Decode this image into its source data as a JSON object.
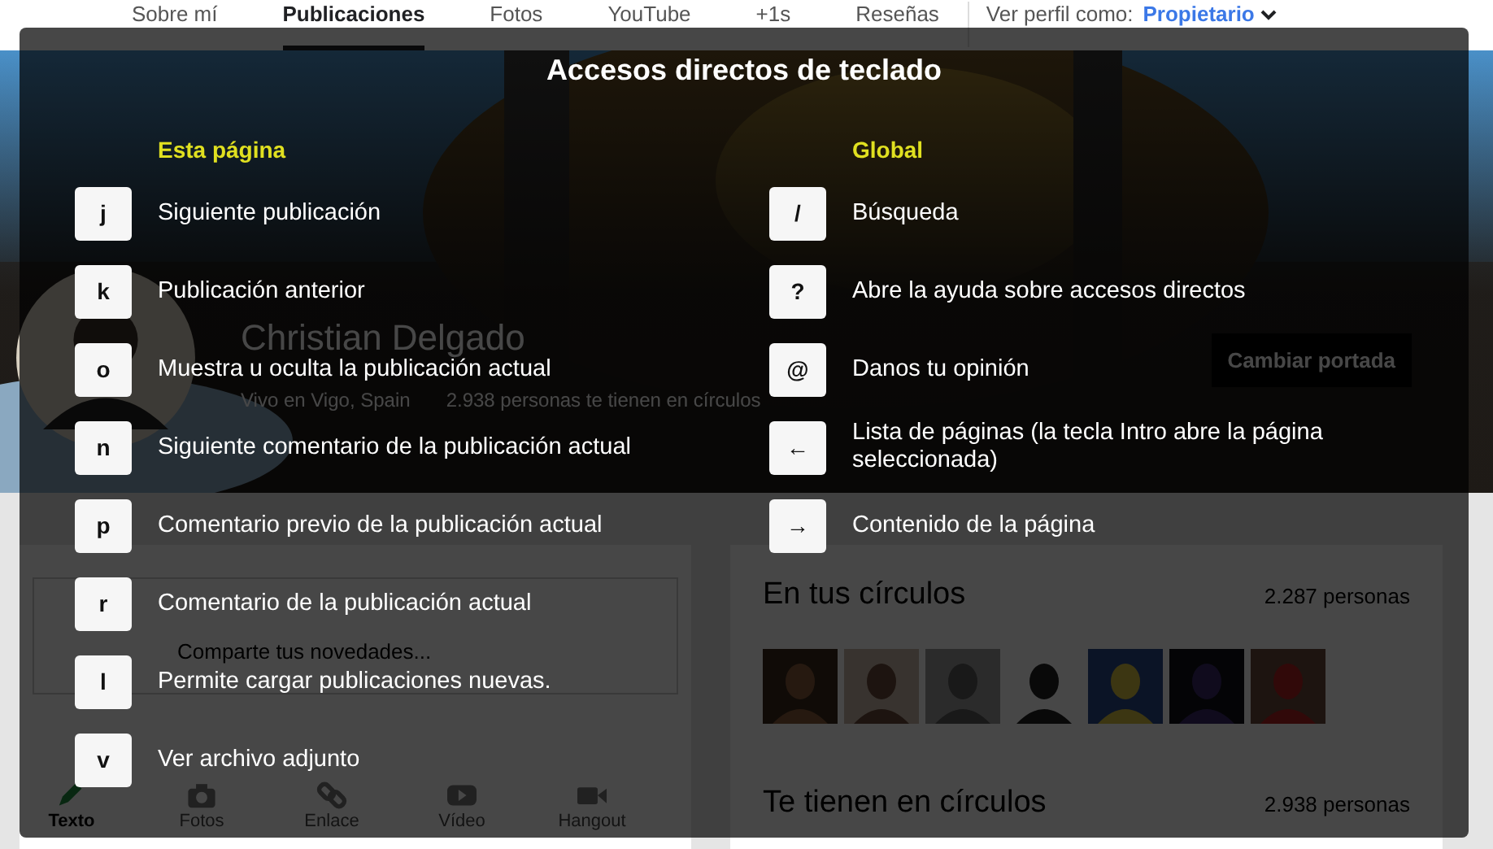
{
  "nav": {
    "tabs": [
      {
        "label": "Sobre mí",
        "selected": false
      },
      {
        "label": "Publicaciones",
        "selected": true
      },
      {
        "label": "Fotos",
        "selected": false
      },
      {
        "label": "YouTube",
        "selected": false
      },
      {
        "label": "+1s",
        "selected": false
      },
      {
        "label": "Reseñas",
        "selected": false
      }
    ],
    "view_as_label": "Ver perfil como:",
    "view_as_value": "Propietario"
  },
  "profile": {
    "name": "Christian Delgado",
    "location": "Vivo en Vigo, Spain",
    "followers": "2.938 personas te tienen en círculos",
    "cover_button": "Cambiar portada"
  },
  "share": {
    "placeholder": "Comparte tus novedades...",
    "actions": [
      {
        "label": "Texto",
        "kind": "text",
        "selected": true
      },
      {
        "label": "Fotos",
        "selected": false
      },
      {
        "label": "Enlace",
        "kind": "link",
        "selected": false
      },
      {
        "label": "Vídeo",
        "kind": "video",
        "selected": false
      },
      {
        "label": "Hangout",
        "kind": "hangout",
        "selected": false
      }
    ]
  },
  "circles": [
    {
      "title": "En tus círculos",
      "count": "2.287 personas"
    },
    {
      "title": "Te tienen en círculos",
      "count": "2.938 personas"
    }
  ],
  "dialog": {
    "title": "Accesos directos de teclado",
    "sections": [
      {
        "heading": "Esta página",
        "shortcuts": [
          {
            "key": "j",
            "description": "Siguiente publicación"
          },
          {
            "key": "k",
            "description": "Publicación anterior"
          },
          {
            "key": "o",
            "description": "Muestra u oculta la publicación actual"
          },
          {
            "key": "n",
            "description": "Siguiente comentario de la publicación actual"
          },
          {
            "key": "p",
            "description": "Comentario previo de la publicación actual"
          },
          {
            "key": "r",
            "description": "Comentario de la publicación actual"
          },
          {
            "key": "l",
            "description": "Permite cargar publicaciones nuevas."
          },
          {
            "key": "v",
            "description": "Ver archivo adjunto"
          }
        ]
      },
      {
        "heading": "Global",
        "shortcuts": [
          {
            "key": "/",
            "description": "Búsqueda"
          },
          {
            "key": "?",
            "description": "Abre la ayuda sobre accesos directos"
          },
          {
            "key": "@",
            "description": "Danos tu opinión"
          },
          {
            "key": "←",
            "description": "Lista de páginas (la tecla Intro abre la página seleccionada)"
          },
          {
            "key": "→",
            "description": "Contenido de la página"
          }
        ]
      }
    ]
  }
}
